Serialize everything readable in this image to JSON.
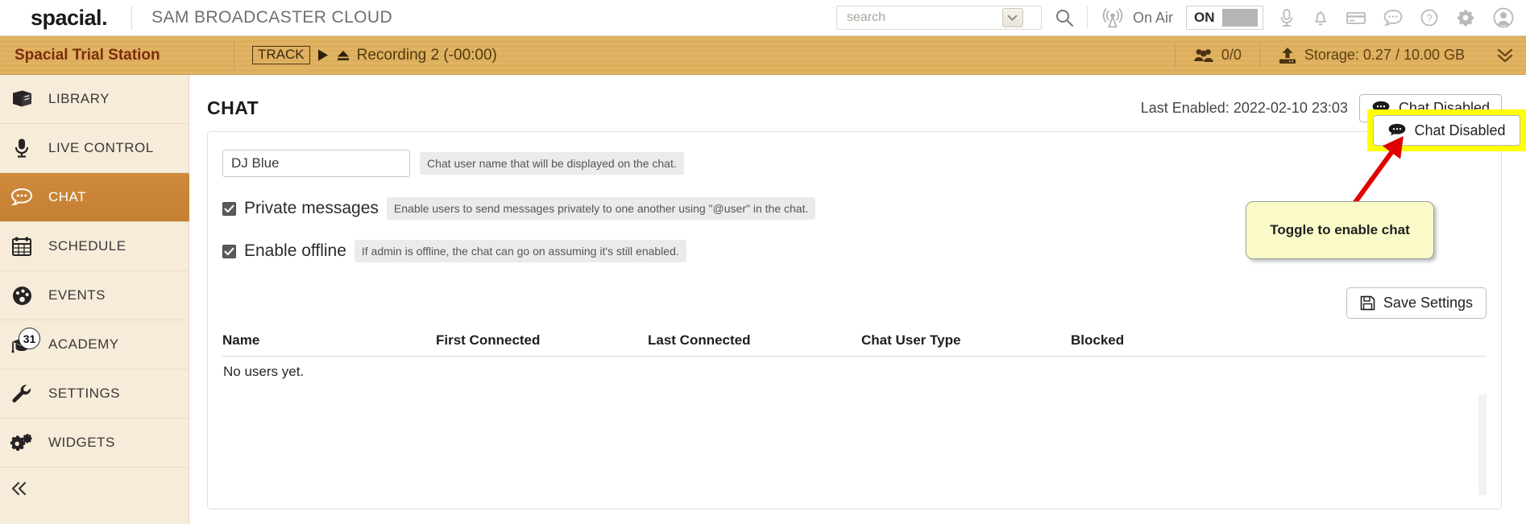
{
  "topbar": {
    "logo": "spacial",
    "logo_dot": ".",
    "app_title": "SAM BROADCASTER CLOUD",
    "search_placeholder": "search",
    "search_value": "",
    "on_air_label": "On Air",
    "toggle_state": "ON",
    "icons": [
      "microphone-icon",
      "bell-icon",
      "credit-card-icon",
      "chat-icon",
      "help-icon",
      "gear-icon",
      "user-avatar-icon"
    ]
  },
  "stationbar": {
    "station_name": "Spacial Trial Station",
    "track_badge": "TRACK",
    "track_title": "Recording 2 (-00:00)",
    "listeners": "0/0",
    "storage": "Storage: 0.27 / 10.00 GB"
  },
  "sidebar": {
    "items": [
      {
        "label": "LIBRARY",
        "icon": "book-icon",
        "active": false
      },
      {
        "label": "LIVE CONTROL",
        "icon": "microphone-icon",
        "active": false
      },
      {
        "label": "CHAT",
        "icon": "chat-bubble-icon",
        "active": true
      },
      {
        "label": "SCHEDULE",
        "icon": "calendar-icon",
        "active": false
      },
      {
        "label": "EVENTS",
        "icon": "dashboard-icon",
        "active": false
      },
      {
        "label": "ACADEMY",
        "icon": "graduation-cap-icon",
        "active": false,
        "badge": "31"
      },
      {
        "label": "SETTINGS",
        "icon": "wrench-icon",
        "active": false
      },
      {
        "label": "WIDGETS",
        "icon": "gears-icon",
        "active": false
      }
    ],
    "collapse_glyph": "«"
  },
  "main": {
    "page_title": "CHAT",
    "last_enabled": "Last Enabled: 2022-02-10 23:03",
    "chat_toggle_label": "Chat Disabled",
    "user_name_value": "DJ Blue",
    "user_name_hint": "Chat user name that will be displayed on the chat.",
    "private_messages_label": "Private messages",
    "private_messages_hint": "Enable users to send messages privately to one another using \"@user\" in the chat.",
    "private_messages_checked": true,
    "enable_offline_label": "Enable offline",
    "enable_offline_hint": "If admin is offline, the chat can go on assuming it's still enabled.",
    "enable_offline_checked": true,
    "save_label": "Save Settings",
    "table": {
      "headers": [
        "Name",
        "First Connected",
        "Last Connected",
        "Chat User Type",
        "Blocked"
      ],
      "empty_message": "No users yet.",
      "rows": []
    }
  },
  "annotation": {
    "callout_text": "Toggle to enable chat",
    "highlight_color": "#ffff00",
    "arrow_color": "#e00000"
  }
}
